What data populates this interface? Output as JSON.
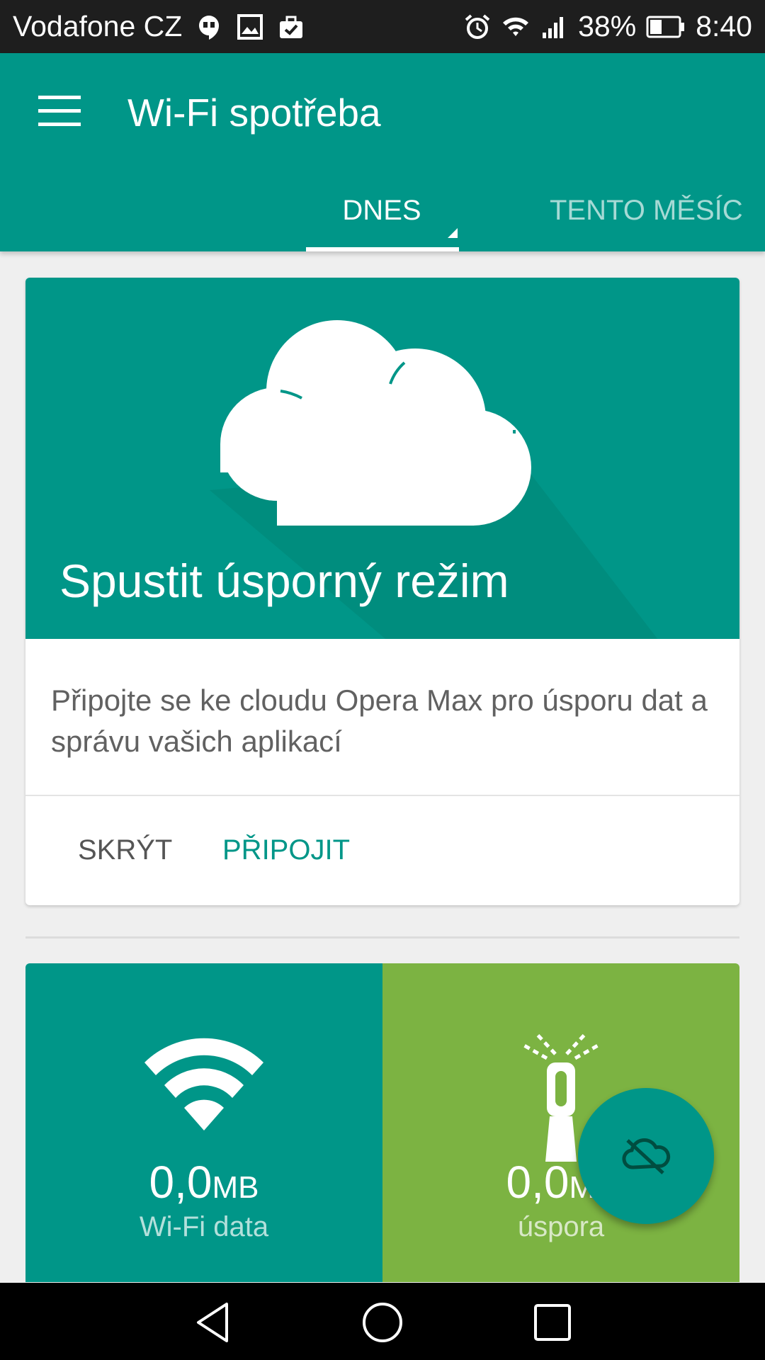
{
  "status_bar": {
    "carrier": "Vodafone CZ",
    "battery": "38%",
    "time": "8:40",
    "icons": [
      "hangouts-icon",
      "image-icon",
      "briefcase-icon",
      "alarm-icon",
      "wifi-icon",
      "signal-icon",
      "battery-icon"
    ]
  },
  "app_bar": {
    "title": "Wi-Fi spotřeba",
    "menu_icon": "hamburger-menu-icon"
  },
  "tabs": [
    {
      "label": "DNES",
      "selected": true
    },
    {
      "label": "TENTO MĚSÍC",
      "selected": false
    }
  ],
  "promo_card": {
    "title": "Spustit úsporný režim",
    "description": "Připojte se ke cloudu Opera Max pro úsporu dat a správu vašich aplikací",
    "hide_label": "SKRÝT",
    "connect_label": "PŘIPOJIT"
  },
  "stats": {
    "wifi": {
      "value": "0,0",
      "unit": "MB",
      "label": "Wi-Fi data",
      "icon": "wifi-icon"
    },
    "savings": {
      "value": "0,0",
      "unit": "MB",
      "label": "úspora",
      "icon": "zipper-icon"
    }
  },
  "fab": {
    "icon": "cloud-off-icon"
  },
  "nav_bar": {
    "icons": [
      "back-icon",
      "home-icon",
      "recents-icon"
    ]
  },
  "colors": {
    "primary": "#009688",
    "savings": "#7cb342",
    "status_bar": "#1e1e1e"
  }
}
